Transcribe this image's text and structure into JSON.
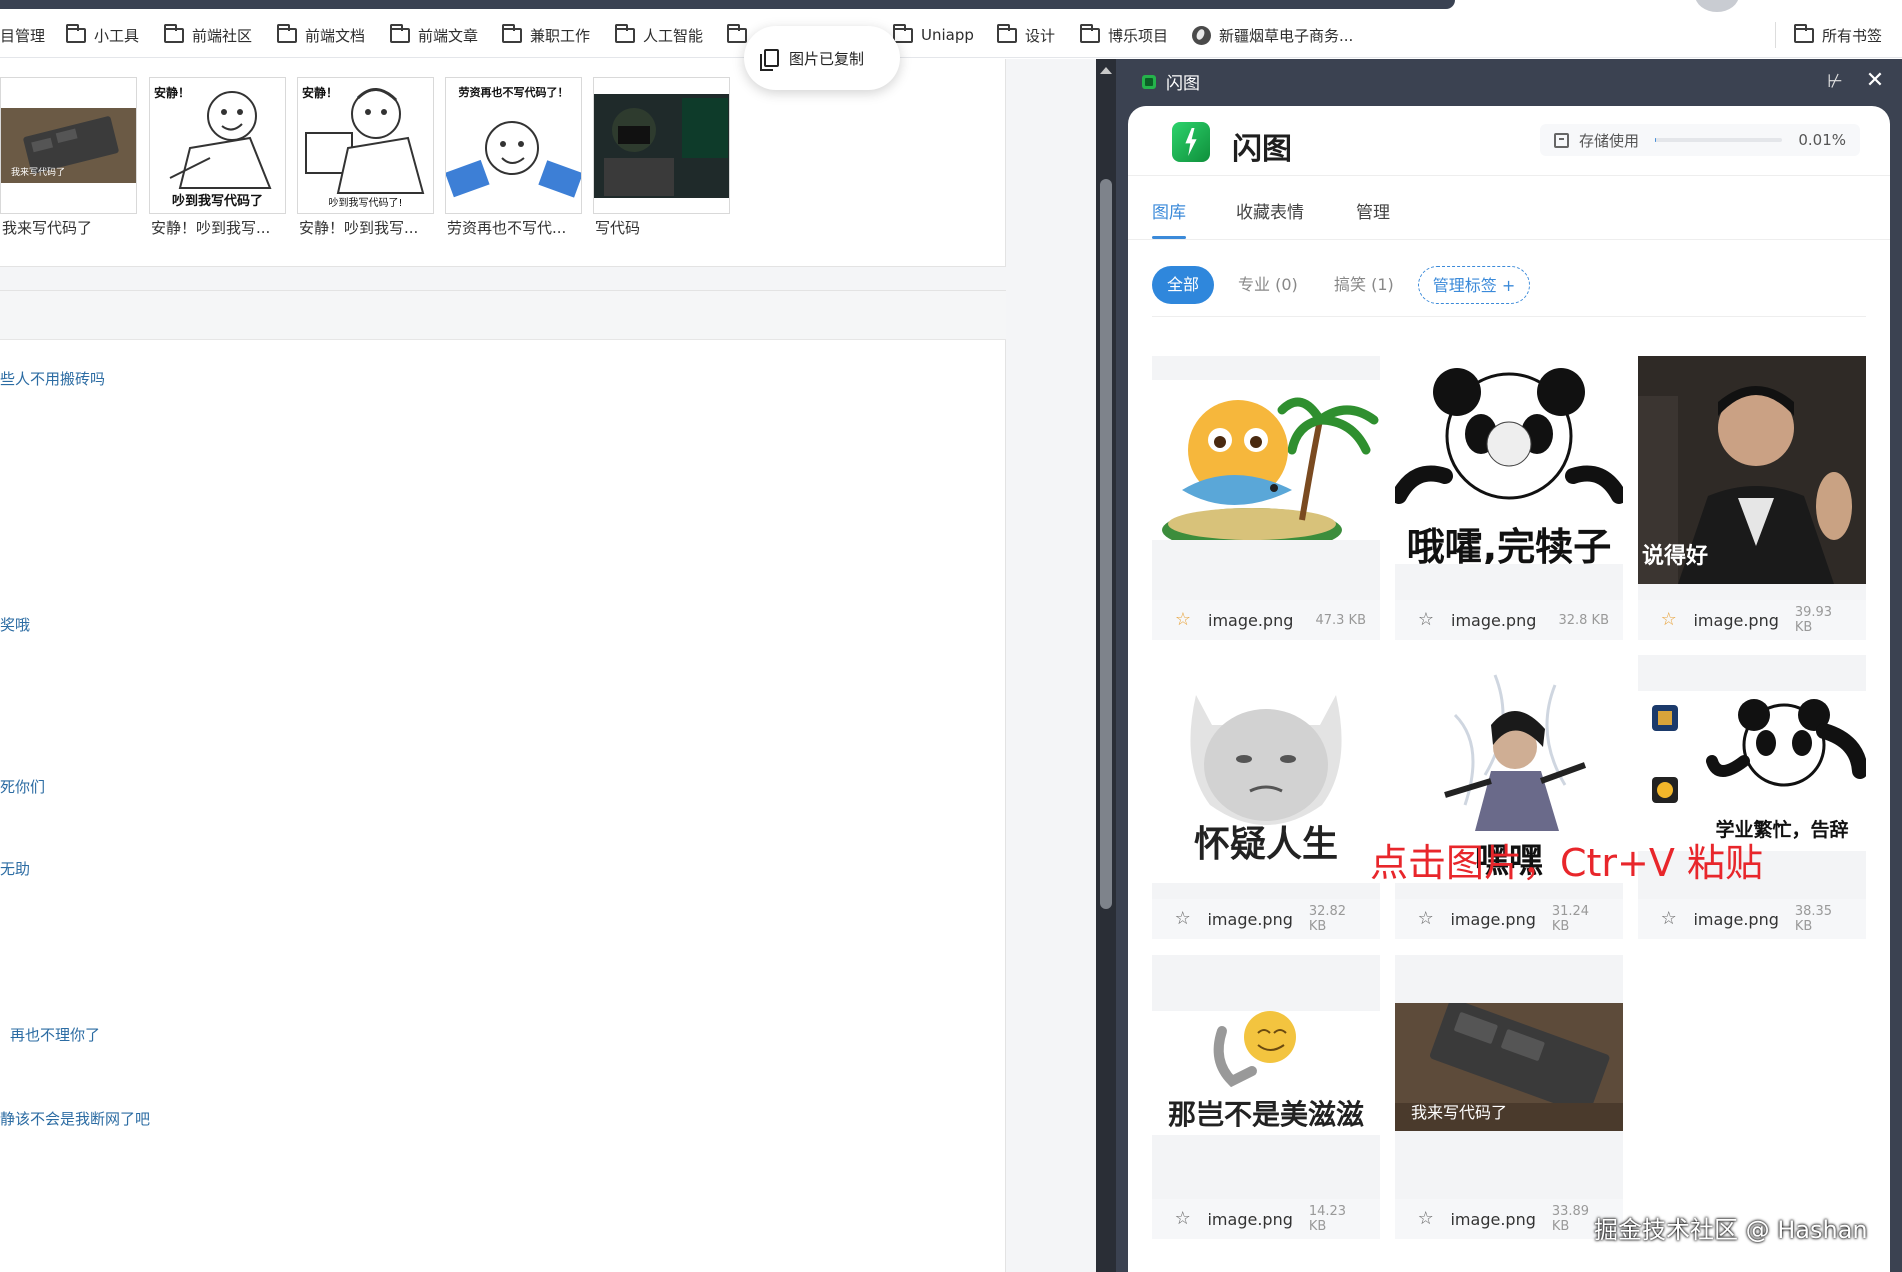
{
  "bookmarks": [
    {
      "label": "目管理",
      "icon": "none"
    },
    {
      "label": "小工具",
      "icon": "folder-icon"
    },
    {
      "label": "前端社区",
      "icon": "folder-icon"
    },
    {
      "label": "前端文档",
      "icon": "folder-icon"
    },
    {
      "label": "前端文章",
      "icon": "folder-icon"
    },
    {
      "label": "兼职工作",
      "icon": "folder-icon"
    },
    {
      "label": "人工智能",
      "icon": "folder-icon"
    },
    {
      "label": "",
      "icon": "folder-icon"
    },
    {
      "label": "Uniapp",
      "icon": "folder-icon"
    },
    {
      "label": "设计",
      "icon": "folder-icon"
    },
    {
      "label": "博乐项目",
      "icon": "folder-icon"
    },
    {
      "label": "新疆烟草电子商务...",
      "icon": "globe-icon"
    },
    {
      "label": "所有书签",
      "icon": "folder-icon"
    }
  ],
  "toast": {
    "text": "图片已复制",
    "icon": "copy-icon"
  },
  "left_page": {
    "thumbs": [
      {
        "caption": "我来写代码了",
        "image_text": "我来写代码了"
      },
      {
        "caption": "安静！吵到我写...",
        "image_text": "安静！ 吵到我写代码了"
      },
      {
        "caption": "安静！吵到我写...",
        "image_text": "安静！ 吵到我写代码了!"
      },
      {
        "caption": "劳资再也不写代...",
        "image_text": "劳资再也不写代码了！"
      },
      {
        "caption": "写代码",
        "image_text": ""
      }
    ],
    "lines": [
      "些人不用搬砖吗",
      "奖哦",
      "死你们",
      "无助",
      "再也不理你了",
      "静该不会是我断网了吧"
    ]
  },
  "panel": {
    "window_title": "闪图",
    "app_name": "闪图",
    "storage": {
      "label": "存储使用",
      "value": "0.01%",
      "fraction": 0.0001
    },
    "tabs": [
      "图库",
      "收藏表情",
      "管理"
    ],
    "active_tab": 0,
    "filters": {
      "all": "全部",
      "pro": "专业 (0)",
      "funny": "搞笑 (1)",
      "manage": "管理标签 +"
    },
    "images": [
      {
        "name": "image.png",
        "size": "47.3 KB",
        "starred": true,
        "caption": ""
      },
      {
        "name": "image.png",
        "size": "32.8 KB",
        "starred": false,
        "caption": "哦嚯,完犊子"
      },
      {
        "name": "image.png",
        "size": "39.93 KB",
        "starred": true,
        "caption": "说得好"
      },
      {
        "name": "image.png",
        "size": "32.82 KB",
        "starred": false,
        "caption": "怀疑人生"
      },
      {
        "name": "image.png",
        "size": "31.24 KB",
        "starred": false,
        "caption": "嘿嘿"
      },
      {
        "name": "image.png",
        "size": "38.35 KB",
        "starred": false,
        "caption": "学业繁忙，告辞"
      },
      {
        "name": "image.png",
        "size": "14.23 KB",
        "starred": false,
        "caption": "那岂不是美滋滋"
      },
      {
        "name": "image.png",
        "size": "33.89 KB",
        "starred": false,
        "caption": "我来写代码了"
      }
    ]
  },
  "overlay_hint": "点击图片，Ctr+V 粘贴",
  "watermark": "掘金技术社区 @ Hashan",
  "colors": {
    "accent": "#2f87dc",
    "panel_frame": "#3b4251",
    "hint_red": "#e8262b",
    "star_active": "#e8a33b"
  }
}
